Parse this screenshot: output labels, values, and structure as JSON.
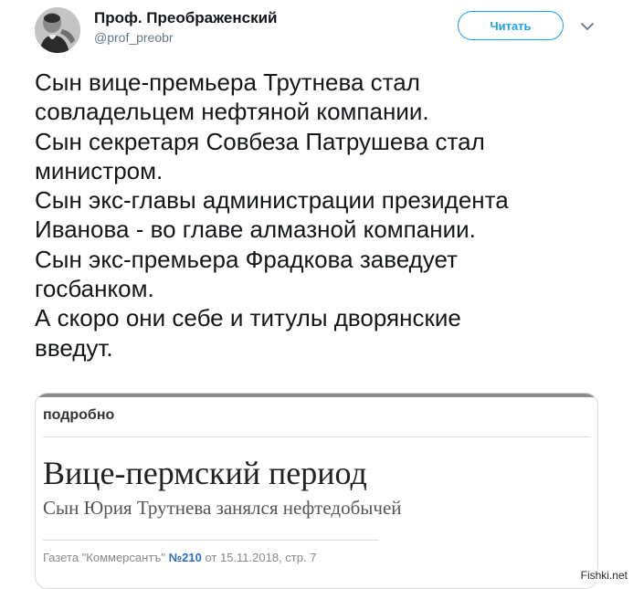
{
  "author": {
    "name": "Проф. Преображенский",
    "handle": "@prof_preobr"
  },
  "follow_button": {
    "label": "Читать"
  },
  "menu_icon": "chevron-down-icon",
  "tweet": {
    "lines": [
      "Сын вице-премьера Трутнева стал",
      "совладельцем нефтяной компании.",
      "Сын секретаря Совбеза Патрушева стал",
      "министром.",
      "Сын экс-главы администрации президента",
      "Иванова - во главе алмазной компании.",
      "Сын экс-премьера Фрадкова заведует",
      "госбанком.",
      "А скоро они себе и титулы дворянские",
      "введут."
    ]
  },
  "card": {
    "section": "подробно",
    "headline": "Вице-пермский период",
    "subtitle": "Сын Юрия Трутнева занялся нефтедобычей",
    "source_prefix": "Газета \"Коммерсантъ\"",
    "source_number": "№210",
    "source_suffix": "от 15.11.2018, стр. 7"
  },
  "watermark": "Fishki.net",
  "colors": {
    "accent": "#1da1f2",
    "text": "#14171a",
    "muted": "#657786",
    "issue_number": "#2b6cc4"
  }
}
